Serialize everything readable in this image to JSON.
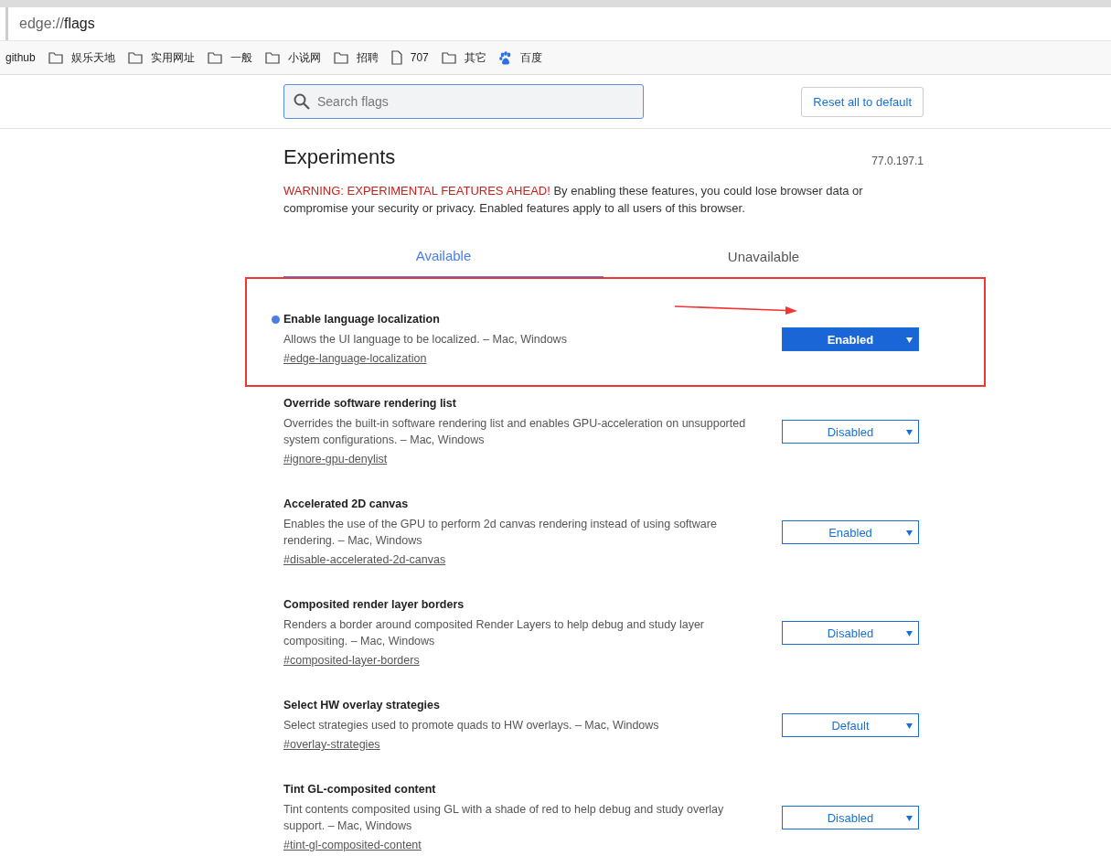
{
  "address_bar": {
    "scheme": "edge://",
    "path": "flags"
  },
  "bookmarks": [
    {
      "kind": "plain",
      "label": "github"
    },
    {
      "kind": "folder",
      "label": "娱乐天地"
    },
    {
      "kind": "folder",
      "label": "实用网址"
    },
    {
      "kind": "folder",
      "label": "一般"
    },
    {
      "kind": "folder",
      "label": "小说网"
    },
    {
      "kind": "folder",
      "label": "招聘"
    },
    {
      "kind": "page",
      "label": "707"
    },
    {
      "kind": "folder",
      "label": "其它"
    },
    {
      "kind": "paw",
      "label": "百度"
    }
  ],
  "search": {
    "placeholder": "Search flags"
  },
  "reset_button": "Reset all to default",
  "title": "Experiments",
  "version": "77.0.197.1",
  "warning": {
    "alert": "WARNING: EXPERIMENTAL FEATURES AHEAD!",
    "text": "By enabling these features, you could lose browser data or compromise your security or privacy. Enabled features apply to all users of this browser."
  },
  "tabs": [
    {
      "label": "Available",
      "selected": true
    },
    {
      "label": "Unavailable",
      "selected": false
    }
  ],
  "flags": [
    {
      "name": "Enable language localization",
      "description": "Allows the UI language to be localized. – Mac, Windows",
      "link": "#edge-language-localization",
      "value": "Enabled",
      "modified": true,
      "highlighted": true
    },
    {
      "name": "Override software rendering list",
      "description": "Overrides the built-in software rendering list and enables GPU-acceleration on unsupported system configurations. – Mac, Windows",
      "link": "#ignore-gpu-denylist",
      "value": "Disabled",
      "modified": false,
      "highlighted": false
    },
    {
      "name": "Accelerated 2D canvas",
      "description": "Enables the use of the GPU to perform 2d canvas rendering instead of using software rendering. – Mac, Windows",
      "link": "#disable-accelerated-2d-canvas",
      "value": "Enabled",
      "modified": false,
      "highlighted": false
    },
    {
      "name": "Composited render layer borders",
      "description": "Renders a border around composited Render Layers to help debug and study layer compositing. – Mac, Windows",
      "link": "#composited-layer-borders",
      "value": "Disabled",
      "modified": false,
      "highlighted": false
    },
    {
      "name": "Select HW overlay strategies",
      "description": "Select strategies used to promote quads to HW overlays. – Mac, Windows",
      "link": "#overlay-strategies",
      "value": "Default",
      "modified": false,
      "highlighted": false
    },
    {
      "name": "Tint GL-composited content",
      "description": "Tint contents composited using GL with a shade of red to help debug and study overlay support. – Mac, Windows",
      "link": "#tint-gl-composited-content",
      "value": "Disabled",
      "modified": false,
      "highlighted": false
    }
  ]
}
